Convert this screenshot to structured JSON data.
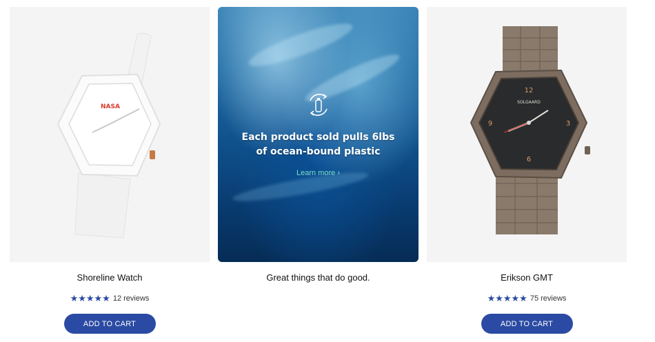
{
  "products": [
    {
      "name": "Shoreline Watch",
      "rating": 5,
      "stars": "★★★★★",
      "reviews": "12 reviews",
      "cta": "ADD TO CART",
      "logo_text": "NASA"
    },
    {
      "name": "Erikson GMT",
      "rating": 5,
      "stars": "★★★★★",
      "reviews": "75 reviews",
      "cta": "ADD TO CART",
      "logo_text": "SOLGAARD"
    }
  ],
  "promo": {
    "headline_line1": "Each product sold pulls 6lbs",
    "headline_line2": "of ocean-bound plastic",
    "link": "Learn more",
    "link_icon": "chevron-right-icon",
    "icon": "recycle-bottle-icon",
    "caption": "Great things that do good."
  },
  "colors": {
    "accent": "#2b4aa3",
    "promo_link": "#7fe0c8",
    "card_bg": "#f4f4f4"
  }
}
